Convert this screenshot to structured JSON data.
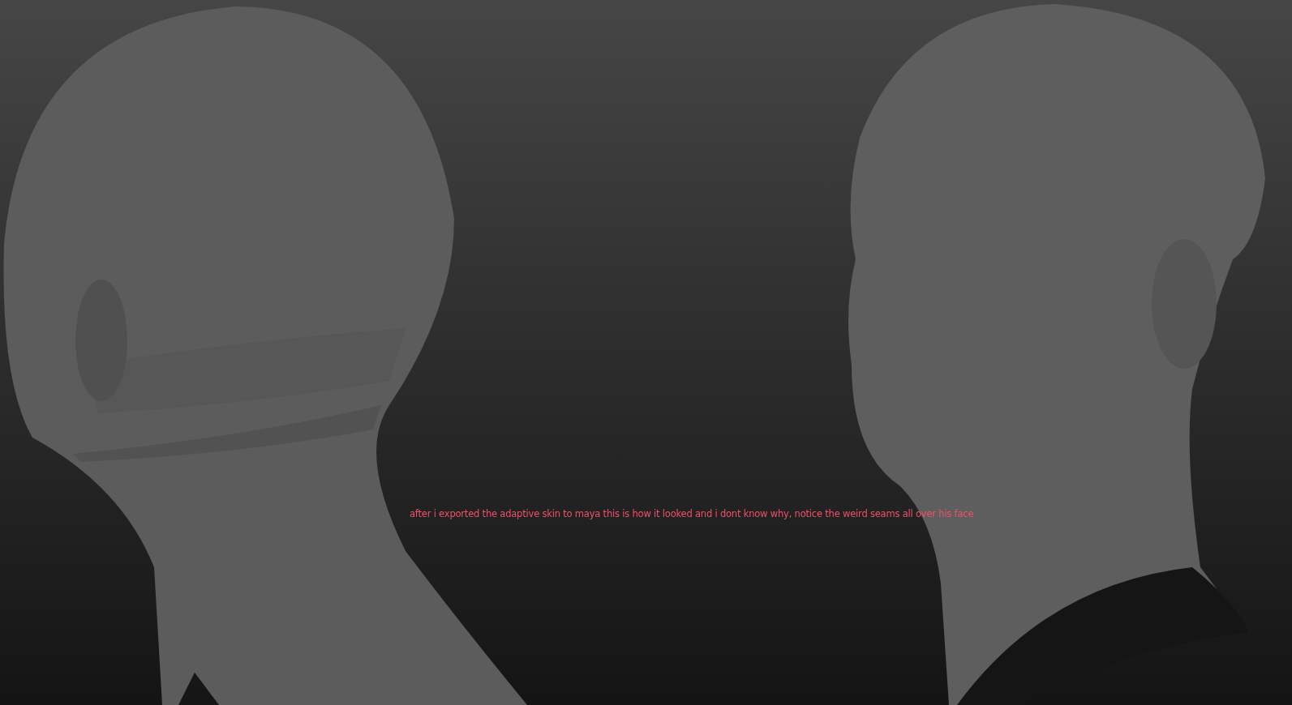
{
  "viewport": {
    "note": "after i exported the adaptive skin to maya this is how it looked and i dont know why, notice the weird seams all over his face"
  }
}
